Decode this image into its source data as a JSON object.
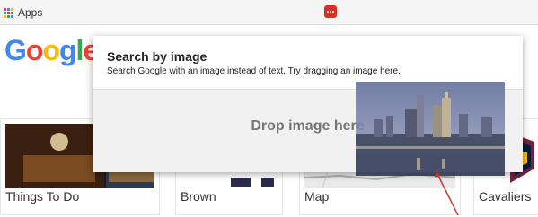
{
  "bookmarks_bar": {
    "apps_label": "Apps"
  },
  "logo": {
    "text": "Google"
  },
  "tiles": [
    {
      "label": "Things To Do"
    },
    {
      "label": "Brown"
    },
    {
      "label": "Map"
    },
    {
      "label": "Cavaliers"
    }
  ],
  "dialog": {
    "title": "Search by image",
    "subtitle": "Search Google with an image instead of text. Try dragging an image here.",
    "drop_text": "Drop image here"
  },
  "colors": {
    "google_blue": "#4285f4",
    "google_red": "#ea4335",
    "google_yellow": "#fbbc05",
    "google_green": "#34a853",
    "extension_red": "#d93025",
    "drop_zone_bg": "#f1f1f1"
  },
  "icons": {
    "apps": "apps-grid-icon",
    "extension": "extension-icon",
    "cursor": "drag-cursor-arrow"
  }
}
